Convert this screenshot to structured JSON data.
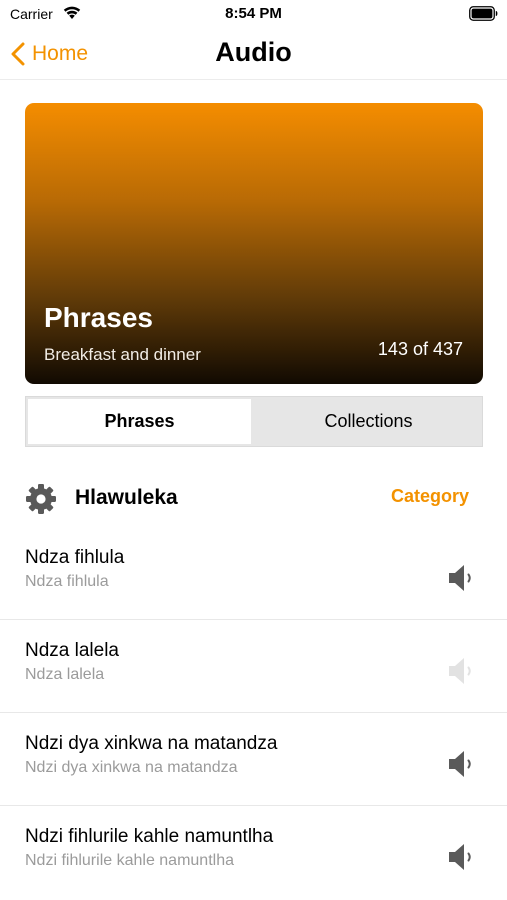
{
  "status_bar": {
    "carrier": "Carrier",
    "time": "8:54 PM"
  },
  "nav": {
    "back_label": "Home",
    "title": "Audio"
  },
  "hero": {
    "title": "Phrases",
    "subtitle": "Breakfast and dinner",
    "count": "143 of 437"
  },
  "segments": {
    "phrases": "Phrases",
    "collections": "Collections",
    "selected": "Phrases"
  },
  "filter": {
    "label": "Hlawuleka",
    "category_button": "Category"
  },
  "phrases": [
    {
      "primary": "Ndza fihlula",
      "secondary": "Ndza fihlula",
      "speaker_state": "active"
    },
    {
      "primary": "Ndza lalela",
      "secondary": "Ndza lalela",
      "speaker_state": "disabled"
    },
    {
      "primary": "Ndzi dya xinkwa na matandza",
      "secondary": "Ndzi dya xinkwa na matandza",
      "speaker_state": "active"
    },
    {
      "primary": "Ndzi fihlurile kahle namuntlha",
      "secondary": "Ndzi fihlurile kahle namuntlha",
      "speaker_state": "active"
    }
  ],
  "colors": {
    "accent": "#f39200",
    "speaker_active": "#5a5a5a",
    "speaker_disabled": "#e2e2e2",
    "secondary_text": "#9b9b9b"
  },
  "icons": {
    "back": "chevron-left-icon",
    "filter": "gear-icon",
    "speaker": "speaker-icon",
    "wifi": "wifi-icon",
    "battery": "battery-icon"
  }
}
